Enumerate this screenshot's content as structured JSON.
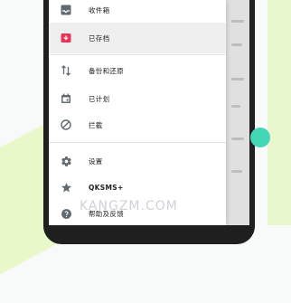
{
  "drawer": {
    "items": [
      {
        "label": "收件箱",
        "icon": "inbox-icon"
      },
      {
        "label": "已存档",
        "icon": "archive-icon",
        "active": true
      },
      {
        "label": "备份和还原",
        "icon": "backup-restore-icon"
      },
      {
        "label": "已计划",
        "icon": "scheduled-icon"
      },
      {
        "label": "拦截",
        "icon": "block-icon"
      },
      {
        "label": "设置",
        "icon": "gear-icon"
      },
      {
        "label": "QKSMS+",
        "icon": "star-icon"
      },
      {
        "label": "帮助及反馈",
        "icon": "help-icon"
      }
    ]
  },
  "watermark": {
    "text": "KANGZM.COM"
  },
  "colors": {
    "archive_accent": "#e8335b",
    "icon_gray": "#606a70",
    "teal": "#45d6b6"
  }
}
